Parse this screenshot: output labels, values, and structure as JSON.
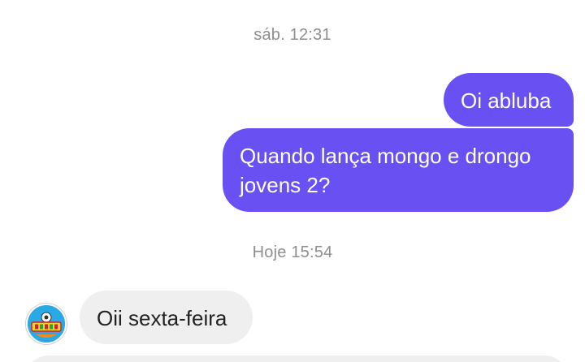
{
  "conversation": {
    "timestamps": [
      "sáb. 12:31",
      "Hoje 15:54"
    ],
    "outgoing": [
      {
        "text": "Oi abluba"
      },
      {
        "lines": [
          "Quando lança mongo e drongo",
          "jovens 2?"
        ]
      }
    ],
    "incoming": [
      {
        "text": "Oii sexta-feira",
        "avatar_icon": "cartoon-logo-avatar"
      }
    ]
  },
  "colors": {
    "outgoing_bubble": "#6950f2",
    "incoming_bubble": "#efefef",
    "timestamp_text": "#8e8e8e",
    "background": "#ffffff"
  }
}
